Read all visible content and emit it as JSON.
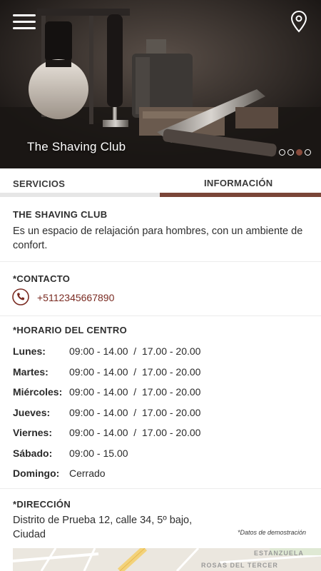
{
  "hero": {
    "title": "The Shaving Club",
    "slides": [
      {
        "active": false
      },
      {
        "active": false
      },
      {
        "active": true
      },
      {
        "active": false
      }
    ]
  },
  "header": {
    "menu_icon": "hamburger-menu-icon",
    "location_icon": "map-pin-icon"
  },
  "tabs": [
    {
      "label": "SERVICIOS",
      "active": false
    },
    {
      "label": "INFORMACIÓN",
      "active": true
    }
  ],
  "info": {
    "name": "THE SHAVING CLUB",
    "description": "Es un espacio de relajación para hombres, con un ambiente de confort."
  },
  "contact": {
    "title": "*CONTACTO",
    "phone_icon": "phone-icon",
    "phone": "+5112345667890"
  },
  "schedule": {
    "title": "*HORARIO DEL CENTRO",
    "rows": [
      {
        "day": "Lunes:",
        "hours": "09:00 - 14.00  /  17.00 - 20.00"
      },
      {
        "day": "Martes:",
        "hours": "09:00 - 14.00  /  17.00 - 20.00"
      },
      {
        "day": "Miércoles:",
        "hours": "09:00 - 14.00  /  17.00 - 20.00"
      },
      {
        "day": "Jueves:",
        "hours": "09:00 - 14.00  /  17.00 - 20.00"
      },
      {
        "day": "Viernes:",
        "hours": "09:00 - 14.00  /  17.00 - 20.00"
      },
      {
        "day": "Sábado:",
        "hours": "09:00 - 15.00"
      },
      {
        "day": "Domingo:",
        "hours": "Cerrado"
      }
    ]
  },
  "address": {
    "title": "*DIRECCIÓN",
    "text": "Distrito de Prueba 12, calle 34, 5º bajo, Ciudad",
    "note": "*Datos de demostración"
  },
  "map": {
    "labels": [
      "ESTANZUELA",
      "ROSAS DEL TERCER"
    ]
  },
  "colors": {
    "accent": "#7a4538",
    "link": "#7a2b22",
    "tab_inactive_bar": "#e6e6e6"
  }
}
